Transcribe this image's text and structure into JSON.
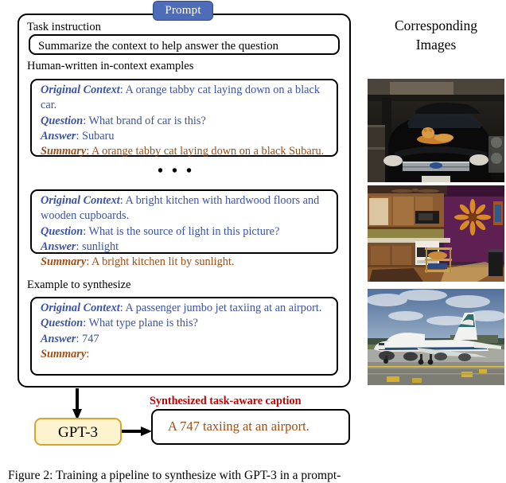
{
  "prompt": {
    "badge_label": "Prompt",
    "task_instruction_label": "Task instruction",
    "task_instruction_text": "Summarize the context to help answer the question",
    "incontext_label": "Human-written in-context examples",
    "ellipsis": "• • •",
    "synthesize_label": "Example to synthesize",
    "field_labels": {
      "original_context": "Original Context",
      "question": "Question",
      "answer": "Answer",
      "summary": "Summary"
    },
    "examples": [
      {
        "original_context": ": A orange tabby cat laying down on a black car.",
        "question": ": What brand of car is this?",
        "answer": ": Subaru",
        "summary": ": A orange tabby cat laying down on a black Subaru."
      },
      {
        "original_context": ": A bright kitchen with hardwood floors and wooden cupboards.",
        "question": ": What is the source of light in this picture?",
        "answer": ": sunlight",
        "summary": ": A bright kitchen lit by sunlight."
      },
      {
        "original_context": ": A passenger jumbo jet taxiing at an airport.",
        "question": ": What type plane is this?",
        "answer": ": 747",
        "summary": ":"
      }
    ]
  },
  "pipeline": {
    "model_label": "GPT-3",
    "output_label": "Synthesized task-aware caption",
    "output_text": "A 747 taxiing at an airport."
  },
  "right_column": {
    "heading_line1": "Corresponding",
    "heading_line2": "Images",
    "photos": [
      {
        "alt": "orange tabby cat laying on the hood of a black Subaru SUV in a dim garage"
      },
      {
        "alt": "bright kitchen with hardwood floors, wooden cupboards and a purple wall"
      },
      {
        "alt": "passenger jumbo jet 747 taxiing at an airport"
      }
    ]
  },
  "figure_caption": "Figure 2: Training a pipeline to synthesize with GPT-3 in a prompt-",
  "colors": {
    "badge_blue": "#4f6cb8",
    "key_blue": "#3b53a4",
    "key_brown": "#9c4f17",
    "caption_red": "#cc0000",
    "gpt3_fill": "#fdf3cf",
    "gpt3_border": "#d6a72c"
  }
}
